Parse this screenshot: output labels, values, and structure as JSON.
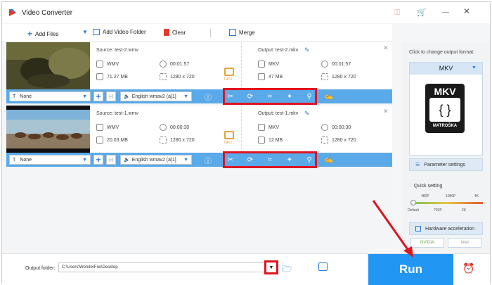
{
  "app": {
    "title": "Video Converter",
    "accent": "#2b7dd6"
  },
  "toolbar": {
    "add_files": "Add Files",
    "add_folder": "Add Video Folder",
    "clear": "Clear",
    "merge": "Merge"
  },
  "items": [
    {
      "source": "Source: test-2.wmv",
      "src_format": "WMV",
      "src_duration": "00:01:57",
      "src_size": "71.27 MB",
      "src_res": "1280 x 720",
      "output": "Output: test-2.mkv",
      "out_format": "MKV",
      "out_duration": "00:01:57",
      "out_size": "47 MB",
      "out_res": "1280 x 720",
      "subtitle": "None",
      "audio": "English wmav2 (a[1]",
      "gpu": "GPU"
    },
    {
      "source": "Source: test-1.wmv",
      "src_format": "WMV",
      "src_duration": "00:00:30",
      "src_size": "20.03 MB",
      "src_res": "1280 x 720",
      "output": "Output: test-1.mkv",
      "out_format": "MKV",
      "out_duration": "00:00:30",
      "out_size": "12 MB",
      "out_res": "1280 x 720",
      "subtitle": "None",
      "audio": "English wmav2 (a[1]",
      "gpu": "GPU"
    }
  ],
  "right": {
    "hint": "Click to change output format:",
    "format": "MKV",
    "logo_text": "MKV",
    "logo_sub": "MATROŠKA",
    "param": "Parameter settings",
    "quick": "Quick setting",
    "q_top": [
      "480P",
      "1080P",
      "4K"
    ],
    "q_bottom": [
      "Default",
      "720P",
      "2K"
    ],
    "hw": "Hardware acceleration",
    "nvidia": "NVIDIA",
    "intel": "Intel"
  },
  "bottom": {
    "output_label": "Output folder:",
    "output_path": "C:\\Users\\WonderFox\\Desktop",
    "run": "Run"
  }
}
